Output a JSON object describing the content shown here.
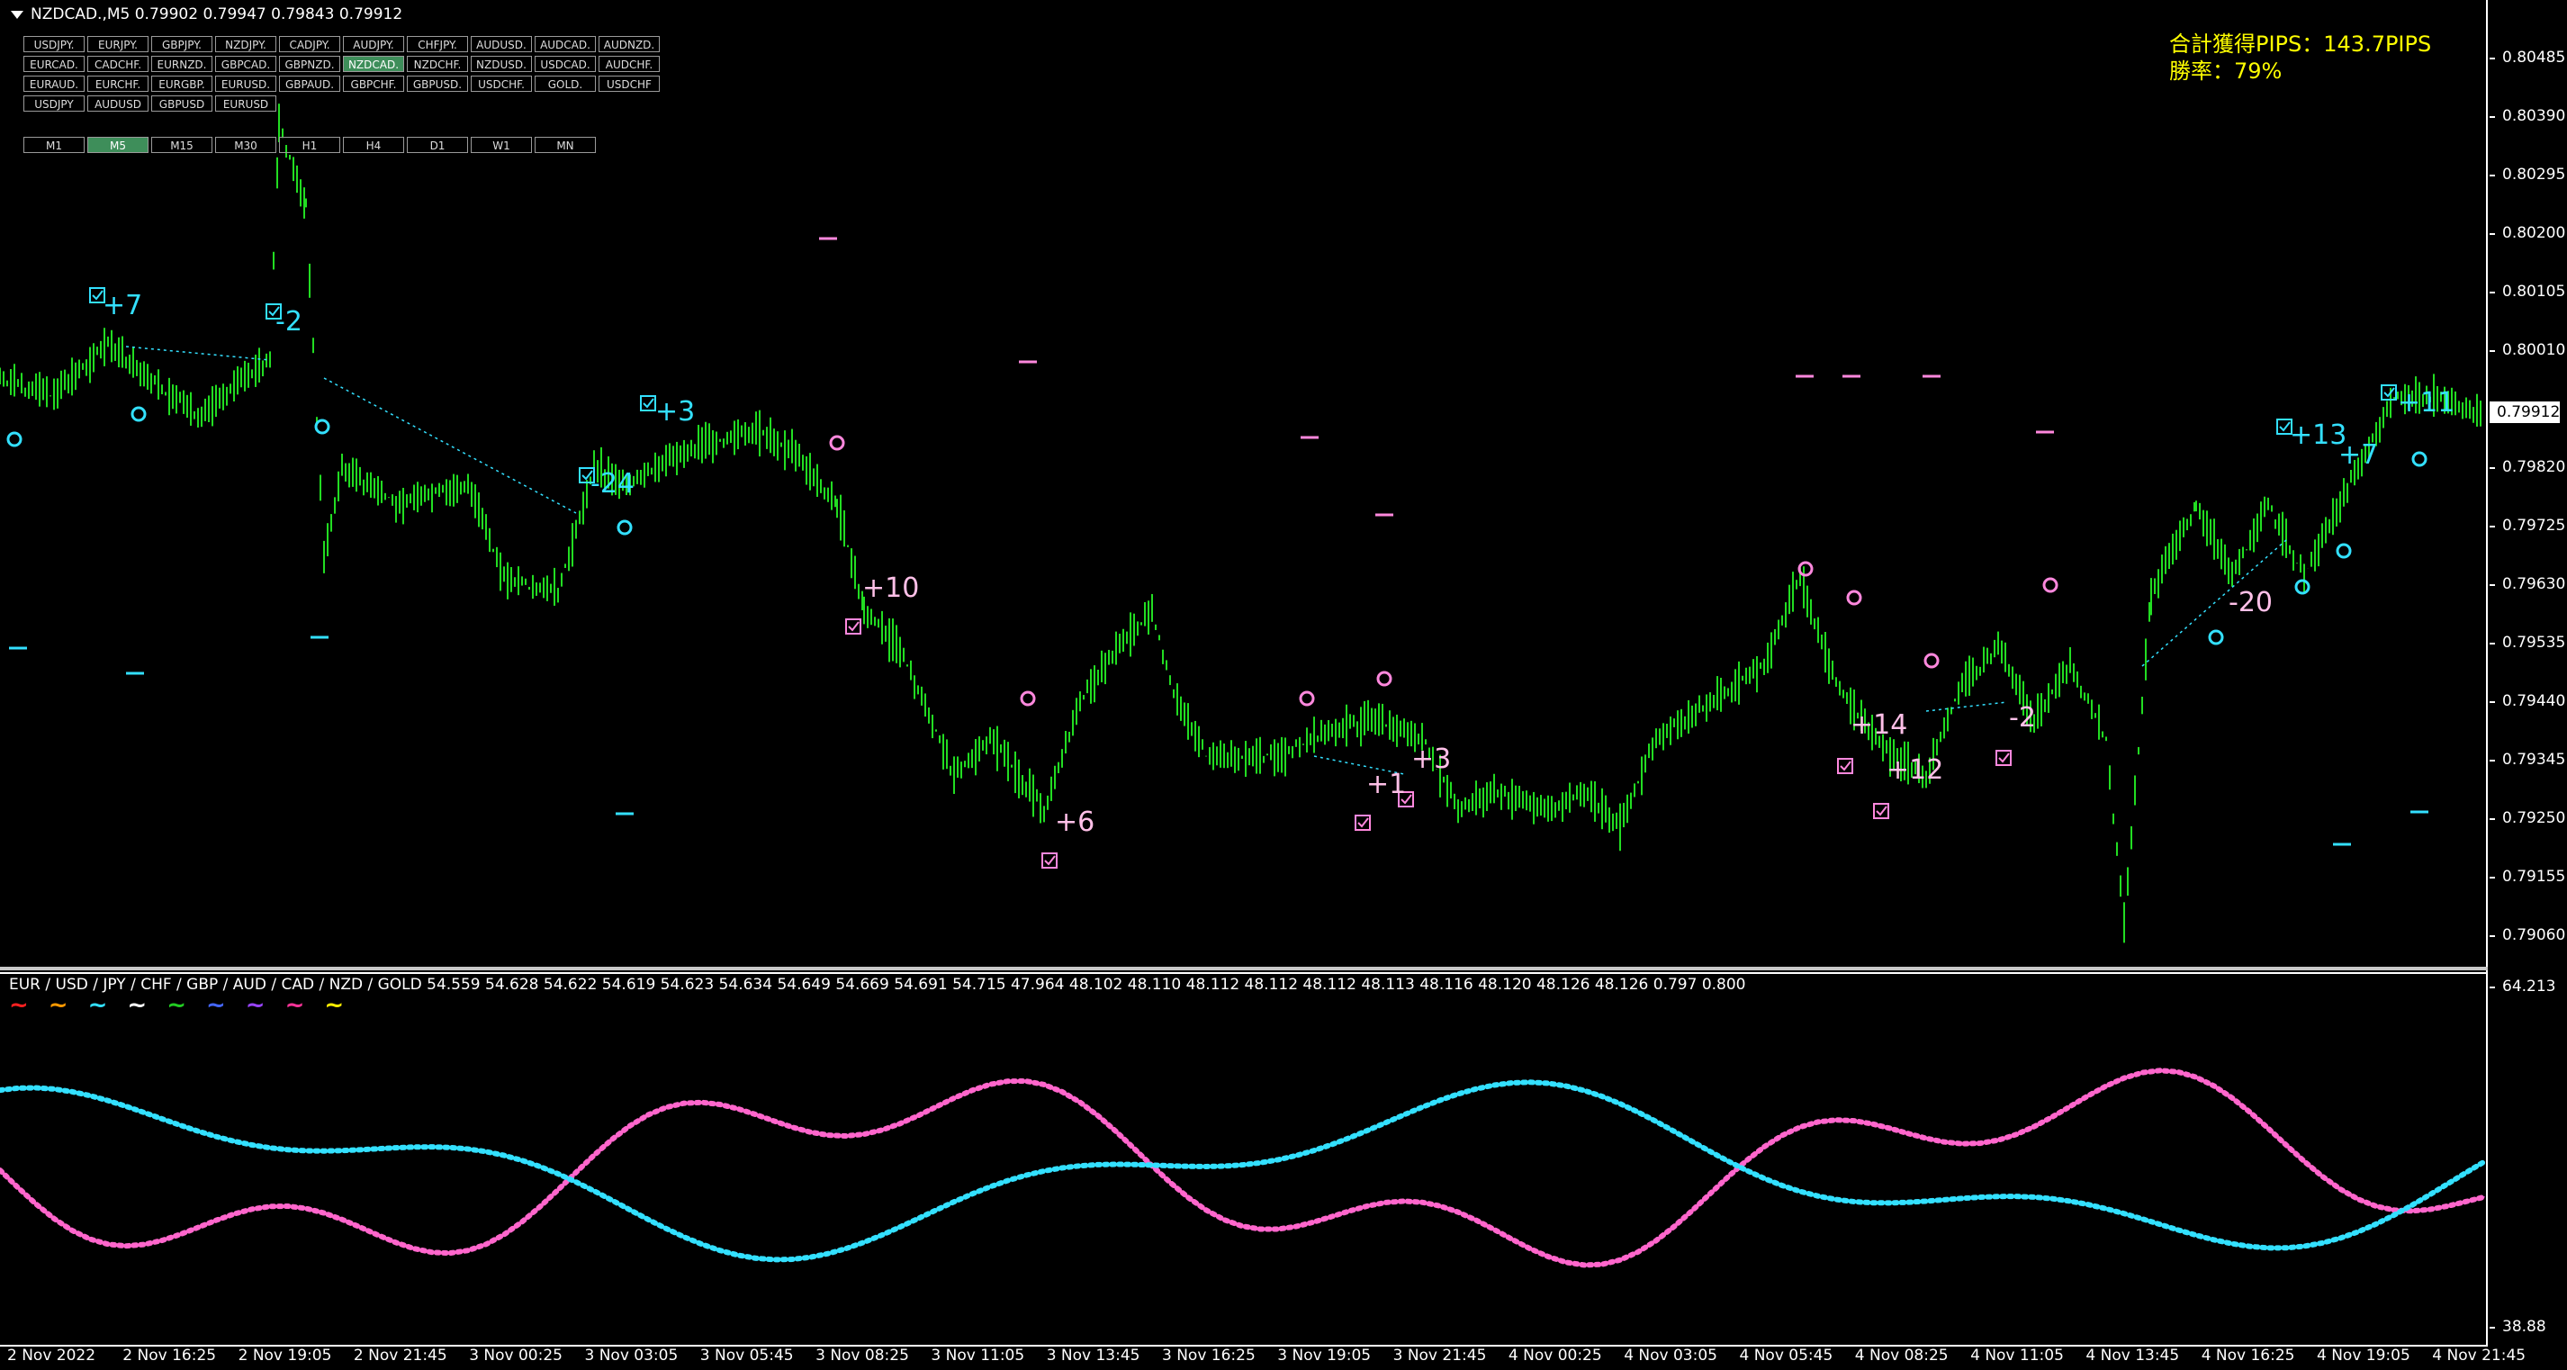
{
  "window": {
    "title": "NZDCAD.,M5  0.79902 0.79947 0.79843 0.79912"
  },
  "pair_buttons": [
    "USDJPY.",
    "EURJPY.",
    "GBPJPY.",
    "NZDJPY.",
    "CADJPY.",
    "AUDJPY.",
    "CHFJPY.",
    "AUDUSD.",
    "AUDCAD.",
    "AUDNZD.",
    "EURCAD.",
    "CADCHF.",
    "EURNZD.",
    "GBPCAD.",
    "GBPNZD.",
    "NZDCAD.",
    "NZDCHF.",
    "NZDUSD.",
    "USDCAD.",
    "AUDCHF.",
    "EURAUD.",
    "EURCHF.",
    "EURGBP.",
    "EURUSD.",
    "GBPAUD.",
    "GBPCHF.",
    "GBPUSD.",
    "USDCHF.",
    "GOLD.",
    "USDCHF",
    "USDJPY",
    "AUDUSD",
    "GBPUSD",
    "EURUSD"
  ],
  "active_pair": "NZDCAD.",
  "timeframes": [
    "M1",
    "M5",
    "M15",
    "M30",
    "H1",
    "H4",
    "D1",
    "W1",
    "MN"
  ],
  "active_timeframe": "M5",
  "stats": {
    "total_pips": "合計獲得PIPS：143.7PIPS",
    "win_rate": "勝率：79%"
  },
  "current_price": "0.79912",
  "price_axis": [
    "0.80485",
    "0.80390",
    "0.80295",
    "0.80200",
    "0.80105",
    "0.80010",
    "0.79912",
    "0.79820",
    "0.79725",
    "0.79630",
    "0.79535",
    "0.79440",
    "0.79345",
    "0.79250",
    "0.79155",
    "0.79060"
  ],
  "indicator_axis": {
    "max": "64.213",
    "min": "38.88"
  },
  "time_axis": [
    "2 Nov 2022",
    "2 Nov 16:25",
    "2 Nov 19:05",
    "2 Nov 21:45",
    "3 Nov 00:25",
    "3 Nov 03:05",
    "3 Nov 05:45",
    "3 Nov 08:25",
    "3 Nov 11:05",
    "3 Nov 13:45",
    "3 Nov 16:25",
    "3 Nov 19:05",
    "3 Nov 21:45",
    "4 Nov 00:25",
    "4 Nov 03:05",
    "4 Nov 05:45",
    "4 Nov 08:25",
    "4 Nov 11:05",
    "4 Nov 13:45",
    "4 Nov 16:25",
    "4 Nov 19:05",
    "4 Nov 21:45"
  ],
  "indicator": {
    "label": "EUR / USD / JPY / CHF / GBP / AUD / CAD / NZD / GOLD  54.559 54.628 54.622 54.619 54.623 54.634 54.649 54.669 54.691 54.715 47.964 48.102 48.110 48.112 48.112 48.112 48.113 48.116 48.120 48.126 48.126 0.797 0.800",
    "legend_colors": [
      "#ff2020",
      "#ff9900",
      "#33e0ff",
      "#ffffff",
      "#22cc22",
      "#4466ff",
      "#9944ff",
      "#ff3399",
      "#ffee00"
    ]
  },
  "trades": [
    {
      "label": "+7",
      "color": "cyan"
    },
    {
      "label": "-2",
      "color": "cyan"
    },
    {
      "label": "+3",
      "color": "cyan"
    },
    {
      "label": "-24",
      "color": "cyan"
    },
    {
      "label": "+10",
      "color": "pink"
    },
    {
      "label": "+6",
      "color": "pink"
    },
    {
      "label": "+1",
      "color": "pink"
    },
    {
      "label": "+3",
      "color": "pink"
    },
    {
      "label": "+14",
      "color": "pink"
    },
    {
      "label": "+12",
      "color": "pink"
    },
    {
      "label": "-2",
      "color": "pink"
    },
    {
      "label": "-20",
      "color": "pink"
    },
    {
      "label": "+13",
      "color": "cyan"
    },
    {
      "label": "+7",
      "color": "cyan"
    },
    {
      "label": "+11",
      "color": "cyan"
    }
  ]
}
